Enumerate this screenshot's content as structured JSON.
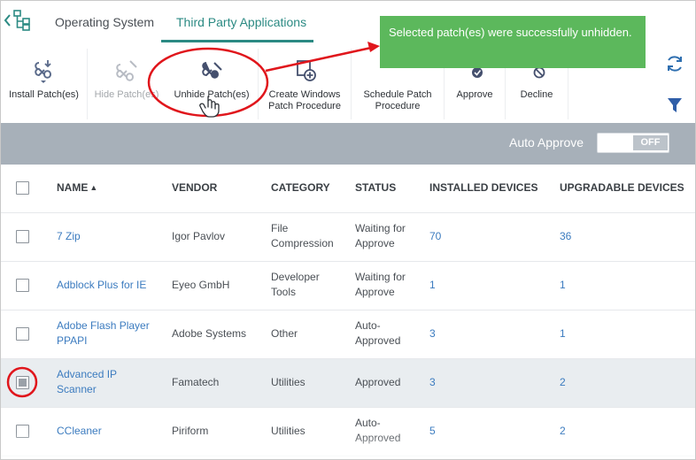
{
  "tabs": {
    "operating_system": "Operating System",
    "third_party": "Third Party Applications"
  },
  "toolbar": {
    "install": "Install Patch(es)",
    "hide": "Hide Patch(es)",
    "unhide": "Unhide Patch(es)",
    "create_line1": "Create Windows",
    "create_line2": "Patch Procedure",
    "schedule_line1": "Schedule Patch",
    "schedule_line2": "Procedure",
    "approve": "Approve",
    "decline": "Decline"
  },
  "toast": {
    "message": "Selected patch(es) were successfully unhidden."
  },
  "auto_approve": {
    "label": "Auto Approve",
    "state": "OFF"
  },
  "table": {
    "headers": {
      "name": "NAME",
      "vendor": "VENDOR",
      "category": "CATEGORY",
      "status": "STATUS",
      "installed": "INSTALLED DEVICES",
      "upgradable": "UPGRADABLE DEVICES"
    },
    "rows": [
      {
        "name_1": "7 Zip",
        "name_2": "",
        "vendor": "Igor Pavlov",
        "category_1": "File",
        "category_2": "Compression",
        "status_1": "Waiting for",
        "status_2": "Approve",
        "installed": "70",
        "upgradable": "36",
        "checked": false
      },
      {
        "name_1": "Adblock Plus for IE",
        "name_2": "",
        "vendor": "Eyeo GmbH",
        "category_1": "Developer",
        "category_2": "Tools",
        "status_1": "Waiting for",
        "status_2": "Approve",
        "installed": "1",
        "upgradable": "1",
        "checked": false
      },
      {
        "name_1": "Adobe Flash Player",
        "name_2": "PPAPI",
        "vendor": "Adobe Systems",
        "category_1": "Other",
        "category_2": "",
        "status_1": "Auto-",
        "status_2": "Approved",
        "installed": "3",
        "upgradable": "1",
        "checked": false
      },
      {
        "name_1": "Advanced IP",
        "name_2": "Scanner",
        "vendor": "Famatech",
        "category_1": "Utilities",
        "category_2": "",
        "status_1": "Approved",
        "status_2": "",
        "installed": "3",
        "upgradable": "2",
        "checked": true
      },
      {
        "name_1": "CCleaner",
        "name_2": "",
        "vendor": "Piriform",
        "category_1": "Utilities",
        "category_2": "",
        "status_1": "Auto-",
        "status_2": "Approved",
        "installed": "5",
        "upgradable": "2",
        "checked": false
      }
    ]
  },
  "colors": {
    "accent_teal": "#2b8a83",
    "toast_green": "#5cb85c",
    "annotation_red": "#e0161c",
    "link_blue": "#3b7bbf",
    "bar_gray": "#a7b0b9"
  },
  "icons": [
    "chevron-left-icon",
    "tree-icon",
    "install-patch-icon",
    "hide-patch-icon",
    "unhide-patch-icon",
    "create-procedure-icon",
    "schedule-icon",
    "approve-icon",
    "decline-icon",
    "refresh-icon",
    "filter-icon",
    "hand-cursor-icon"
  ]
}
